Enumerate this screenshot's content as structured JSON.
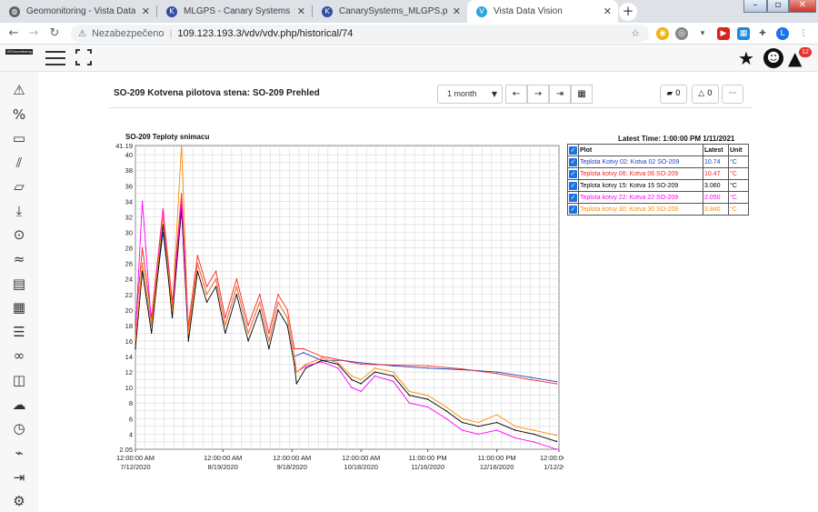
{
  "browser": {
    "tabs": [
      {
        "title": "Geomonitoring - Vista Data Visio",
        "favicon": "globe-icon",
        "active": false
      },
      {
        "title": "MLGPS - Canary Systems",
        "favicon": "canary-icon",
        "active": false
      },
      {
        "title": "CanarySystems_MLGPS.pdf",
        "favicon": "canary-icon",
        "active": false
      },
      {
        "title": "Vista Data Vision",
        "favicon": "vista-icon",
        "active": true
      }
    ],
    "address": {
      "security_label": "Nezabezpečeno",
      "url": "109.123.193.3/vdv/vdv.php/historical/74"
    },
    "profile_initial": "L"
  },
  "app": {
    "logo_text": "GEOmonitoring",
    "alarm_count": "12",
    "sidebar_icons": [
      "alert-triangle-icon",
      "percent-icon",
      "monitor-icon",
      "chart-icon",
      "folder-icon",
      "download-icon",
      "map-pin-icon",
      "trend-icon",
      "keyboard-icon",
      "calendar-icon",
      "report-icon",
      "binoculars-icon",
      "layout-icon",
      "cloud-download-icon",
      "clock-icon",
      "satellite-icon",
      "logout-icon",
      "settings-icon"
    ]
  },
  "page": {
    "title": "SO-209 Kotvena pilotova stena: SO-209 Prehled",
    "range_value": "1 month",
    "comment_count": "0",
    "alarm_count": "0",
    "more_label": "···"
  },
  "chart_header": {
    "title": "SO-209 Teploty snimacu",
    "latest_time": "Latest Time: 1:00:00 PM 1/11/2021"
  },
  "legend": {
    "headers": [
      "Plot",
      "Latest",
      "Unit"
    ],
    "rows": [
      {
        "plot": "Teplota Kotvy 02: Kotva 02 SO-209",
        "latest": "10.74",
        "unit": "°C",
        "color": "#1f3fbf"
      },
      {
        "plot": "Teplota kotvy 06: Kotva 06 SO-209",
        "latest": "10.47",
        "unit": "°C",
        "color": "#ff2020"
      },
      {
        "plot": "Teplota kotvy 15: Kotva 15 SO-209",
        "latest": "3.060",
        "unit": "°C",
        "color": "#000000"
      },
      {
        "plot": "Teplota kotvy 22: Kotva 22 SO-209",
        "latest": "2.050",
        "unit": "°C",
        "color": "#ff00ff"
      },
      {
        "plot": "Teplota kotvy 30: Kotva 30 SO-209",
        "latest": "3.840",
        "unit": "°C",
        "color": "#ff8c00"
      }
    ]
  },
  "chart_data": {
    "type": "line",
    "title": "SO-209 Teploty snimacu",
    "ylim": [
      2.05,
      41.19
    ],
    "yticks": [
      "2.05",
      "4",
      "6",
      "8",
      "10",
      "12",
      "14",
      "16",
      "18",
      "20",
      "22",
      "24",
      "26",
      "28",
      "30",
      "32",
      "34",
      "36",
      "38",
      "40",
      "41.19"
    ],
    "xlim": [
      "2020-07-12",
      "2021-01-12"
    ],
    "xticks": [
      {
        "time": "12:00:00 AM",
        "date": "7/12/2020",
        "x": "2020-07-12"
      },
      {
        "time": "12:00:00 AM",
        "date": "8/19/2020",
        "x": "2020-08-19"
      },
      {
        "time": "12:00:00 AM",
        "date": "9/18/2020",
        "x": "2020-09-18"
      },
      {
        "time": "12:00:00 AM",
        "date": "10/18/2020",
        "x": "2020-10-18"
      },
      {
        "time": "11:00:00 PM",
        "date": "11/16/2020",
        "x": "2020-11-16"
      },
      {
        "time": "11:00:00 PM",
        "date": "12/16/2020",
        "x": "2020-12-16"
      },
      {
        "time": "12:00:00 AM",
        "date": "1/12/2021",
        "x": "2021-01-12"
      }
    ],
    "grid": true,
    "series": [
      {
        "name": "Teplota Kotvy 02: Kotva 02 SO-209",
        "color": "#1f3fbf",
        "x": [
          "2020-07-12",
          "2020-07-15",
          "2020-07-19",
          "2020-07-24",
          "2020-07-28",
          "2020-08-01",
          "2020-08-04",
          "2020-08-08",
          "2020-08-12",
          "2020-08-16",
          "2020-08-20",
          "2020-08-25",
          "2020-08-30",
          "2020-09-04",
          "2020-09-08",
          "2020-09-12",
          "2020-09-16",
          "2020-09-19",
          "2020-09-23",
          "2020-10-01",
          "2020-10-10",
          "2020-10-18",
          "2020-11-01",
          "2020-11-16",
          "2020-12-01",
          "2020-12-16",
          "2020-12-31",
          "2021-01-11"
        ],
        "y": [
          16,
          26,
          18,
          30,
          20,
          33,
          17,
          26,
          22,
          24,
          18,
          23,
          17,
          21,
          16,
          21,
          19,
          14,
          14.5,
          13.5,
          13.5,
          13.2,
          12.8,
          12.5,
          12.3,
          12.0,
          11.3,
          10.74
        ]
      },
      {
        "name": "Teplota kotvy 06: Kotva 06 SO-209",
        "color": "#ff2020",
        "x": [
          "2020-07-12",
          "2020-07-15",
          "2020-07-19",
          "2020-07-24",
          "2020-07-28",
          "2020-08-01",
          "2020-08-04",
          "2020-08-08",
          "2020-08-12",
          "2020-08-16",
          "2020-08-20",
          "2020-08-25",
          "2020-08-30",
          "2020-09-04",
          "2020-09-08",
          "2020-09-12",
          "2020-09-16",
          "2020-09-19",
          "2020-09-23",
          "2020-10-01",
          "2020-10-10",
          "2020-10-18",
          "2020-11-01",
          "2020-11-16",
          "2020-12-01",
          "2020-12-16",
          "2020-12-31",
          "2021-01-11"
        ],
        "y": [
          18,
          28,
          19,
          33,
          21,
          35,
          18,
          27,
          23,
          25,
          19,
          24,
          18,
          22,
          17,
          22,
          20,
          15,
          15,
          14,
          13.5,
          13.0,
          12.9,
          12.8,
          12.4,
          11.8,
          11.0,
          10.47
        ]
      },
      {
        "name": "Teplota kotvy 15: Kotva 15 SO-209",
        "color": "#000000",
        "x": [
          "2020-07-12",
          "2020-07-15",
          "2020-07-19",
          "2020-07-24",
          "2020-07-28",
          "2020-08-01",
          "2020-08-04",
          "2020-08-08",
          "2020-08-12",
          "2020-08-16",
          "2020-08-20",
          "2020-08-25",
          "2020-08-30",
          "2020-09-04",
          "2020-09-08",
          "2020-09-12",
          "2020-09-16",
          "2020-09-19",
          "2020-09-20",
          "2020-09-24",
          "2020-10-01",
          "2020-10-08",
          "2020-10-14",
          "2020-10-18",
          "2020-10-24",
          "2020-11-01",
          "2020-11-08",
          "2020-11-16",
          "2020-11-24",
          "2020-12-01",
          "2020-12-08",
          "2020-12-16",
          "2020-12-24",
          "2021-01-01",
          "2021-01-11"
        ],
        "y": [
          15,
          25,
          17,
          31,
          19,
          33,
          16,
          25,
          21,
          23,
          17,
          22,
          16,
          20,
          15,
          20,
          18,
          13,
          10.5,
          12.5,
          13.5,
          13,
          11,
          10.5,
          12,
          11.5,
          9,
          8.5,
          7,
          5.5,
          5,
          5.5,
          4.5,
          4,
          3.06
        ]
      },
      {
        "name": "Teplota kotvy 22: Kotva 22 SO-209",
        "color": "#ff00ff",
        "x": [
          "2020-07-12",
          "2020-07-15",
          "2020-07-19",
          "2020-07-24",
          "2020-07-28",
          "2020-08-01",
          "2020-08-04",
          "2020-08-08",
          "2020-08-12",
          "2020-08-16",
          "2020-08-20",
          "2020-08-25",
          "2020-08-30",
          "2020-09-04",
          "2020-09-08",
          "2020-09-12",
          "2020-09-16",
          "2020-09-19",
          "2020-09-20",
          "2020-09-24",
          "2020-10-01",
          "2020-10-08",
          "2020-10-14",
          "2020-10-18",
          "2020-10-24",
          "2020-11-01",
          "2020-11-08",
          "2020-11-16",
          "2020-11-24",
          "2020-12-01",
          "2020-12-08",
          "2020-12-16",
          "2020-12-24",
          "2021-01-01",
          "2021-01-11"
        ],
        "y": [
          17,
          34,
          18,
          33,
          20,
          34,
          17,
          26,
          22,
          24,
          18,
          23,
          17,
          21,
          16,
          21,
          19,
          14,
          12,
          12.8,
          13.3,
          12.5,
          10,
          9.5,
          11.5,
          10.8,
          8,
          7.5,
          6,
          4.5,
          4,
          4.5,
          3.5,
          3,
          2.05
        ]
      },
      {
        "name": "Teplota kotvy 30: Kotva 30 SO-209",
        "color": "#ff8c00",
        "x": [
          "2020-07-12",
          "2020-07-15",
          "2020-07-19",
          "2020-07-24",
          "2020-07-28",
          "2020-08-01",
          "2020-08-04",
          "2020-08-08",
          "2020-08-12",
          "2020-08-16",
          "2020-08-20",
          "2020-08-25",
          "2020-08-30",
          "2020-09-04",
          "2020-09-08",
          "2020-09-12",
          "2020-09-16",
          "2020-09-19",
          "2020-09-20",
          "2020-09-24",
          "2020-10-01",
          "2020-10-08",
          "2020-10-14",
          "2020-10-18",
          "2020-10-24",
          "2020-11-01",
          "2020-11-08",
          "2020-11-16",
          "2020-11-24",
          "2020-12-01",
          "2020-12-08",
          "2020-12-16",
          "2020-12-24",
          "2021-01-01",
          "2021-01-11"
        ],
        "y": [
          16,
          26,
          18,
          32,
          20,
          41.19,
          17,
          26,
          22,
          24,
          18,
          23,
          17,
          21,
          16,
          21,
          19,
          14,
          12,
          13,
          13.8,
          13.2,
          11.5,
          11,
          12.5,
          12,
          9.5,
          9,
          7.5,
          6,
          5.5,
          6.5,
          5,
          4.5,
          3.84
        ]
      }
    ]
  },
  "colors": {
    "accent": "#1a73e8",
    "alarm": "#e3342f"
  }
}
